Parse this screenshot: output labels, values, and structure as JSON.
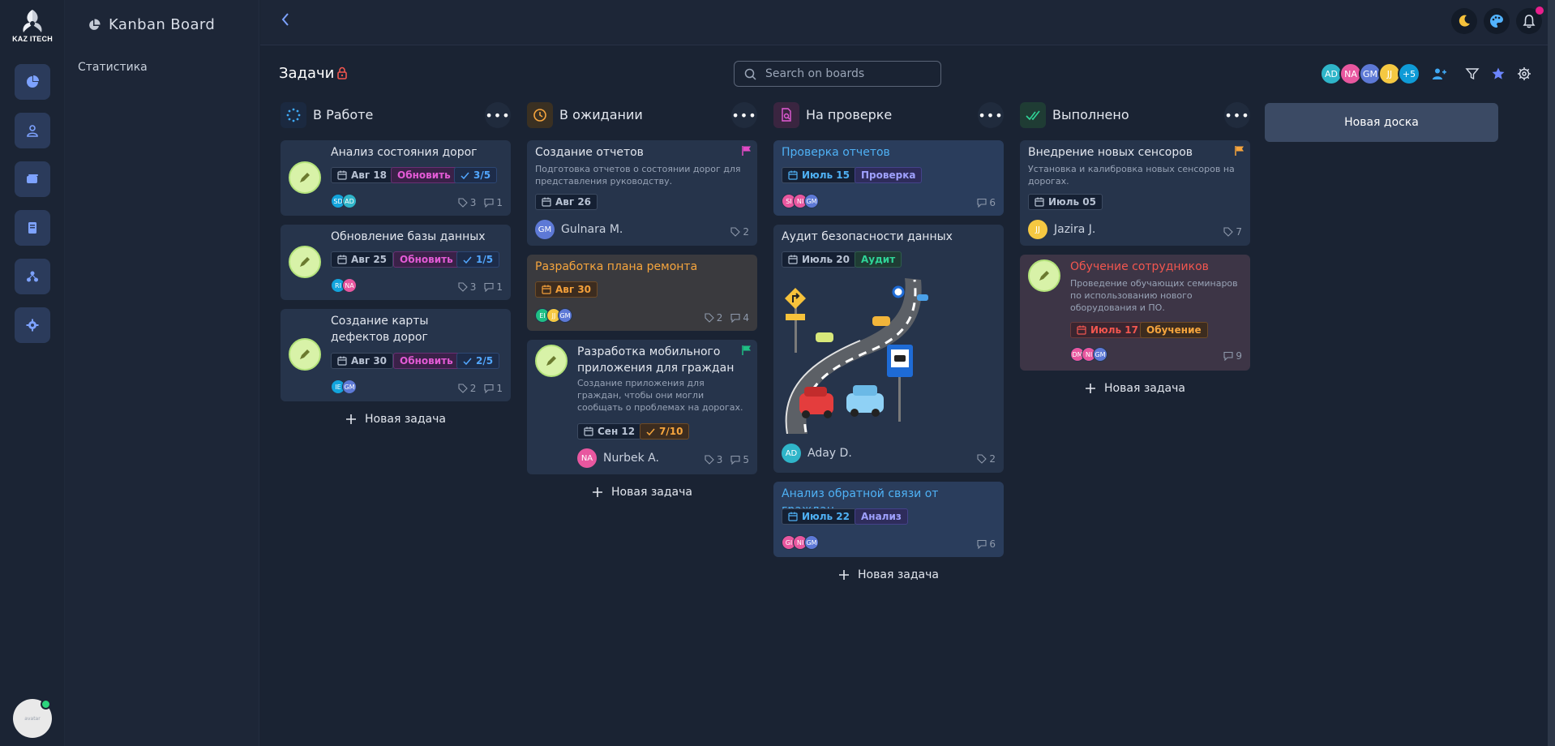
{
  "brand": {
    "logo_text": "KAZ ITECH",
    "avatar_text": "avatar"
  },
  "sidebar": {
    "title": "Kanban Board",
    "items": [
      {
        "label": "Статистика"
      }
    ]
  },
  "board": {
    "title": "Задачи",
    "search_placeholder": "Search on boards",
    "members": [
      "AD",
      "NA",
      "GM",
      "JJ"
    ],
    "members_more": "+5",
    "new_board_label": "Новая доска"
  },
  "columns": [
    {
      "title": "В Работе",
      "new_task_label": "Новая задача",
      "cards": [
        {
          "title": "Анализ состояния дорог",
          "date": "Авг 18",
          "label": "Обновить",
          "progress": "3/5",
          "avatars": [
            "SD",
            "AD"
          ],
          "likes": "3",
          "comments": "1"
        },
        {
          "title": "Обновление базы данных",
          "date": "Авг 25",
          "label": "Обновить",
          "progress": "1/5",
          "avatars": [
            "RI",
            "NA"
          ],
          "likes": "3",
          "comments": "1"
        },
        {
          "title": "Создание карты дефектов дорог",
          "date": "Авг 30",
          "label": "Обновить",
          "progress": "2/5",
          "avatars": [
            "IE",
            "GM"
          ],
          "likes": "2",
          "comments": "1"
        }
      ]
    },
    {
      "title": "В ожидании",
      "new_task_label": "Новая задача",
      "cards": [
        {
          "title": "Создание отчетов",
          "desc": "Подготовка отчетов о состоянии дорог для представления руководству.",
          "date": "Авг 26",
          "assignee": "Gulnara M.",
          "assignee_initials": "GM",
          "likes": "2"
        },
        {
          "title": "Разработка плана ремонта",
          "date": "Авг 30",
          "avatars": [
            "EI",
            "JJ",
            "GM"
          ],
          "likes": "2",
          "comments": "4"
        },
        {
          "title": "Разработка мобильного приложения для граждан",
          "desc": "Создание приложения для граждан, чтобы они могли сообщать о проблемах на дорогах.",
          "date": "Сен 12",
          "progress": "7/10",
          "assignee": "Nurbek A.",
          "assignee_initials": "NA",
          "likes": "3",
          "comments": "5"
        }
      ]
    },
    {
      "title": "На проверке",
      "new_task_label": "Новая задача",
      "cards": [
        {
          "title": "Проверка отчетов",
          "date": "Июль 15",
          "label": "Проверка",
          "avatars": [
            "SI",
            "NI",
            "GM"
          ],
          "comments": "6"
        },
        {
          "title": "Аудит безопасности данных",
          "date": "Июль 20",
          "label": "Аудит",
          "assignee": "Aday D.",
          "assignee_initials": "AD",
          "likes": "2"
        },
        {
          "title": "Анализ обратной связи от граждан",
          "date": "Июль 22",
          "label": "Анализ",
          "avatars": [
            "GI",
            "NI",
            "GM"
          ],
          "comments": "6"
        }
      ]
    },
    {
      "title": "Выполнено",
      "new_task_label": "Новая задача",
      "cards": [
        {
          "title": "Внедрение новых сенсоров",
          "desc": "Установка и калибровка новых сенсоров на дорогах.",
          "date": "Июль 05",
          "assignee": "Jazira J.",
          "assignee_initials": "JJ",
          "likes": "7"
        },
        {
          "title": "Обучение сотрудников",
          "desc": "Проведение обучающих семинаров по использованию нового оборудования и ПО.",
          "date": "Июль 17",
          "label": "Обучение",
          "avatars": [
            "DM",
            "NI",
            "GM"
          ],
          "comments": "9"
        }
      ]
    }
  ],
  "colors": {
    "accent": "#7da2ff",
    "background": "#1a2333",
    "card": "#26344b"
  }
}
